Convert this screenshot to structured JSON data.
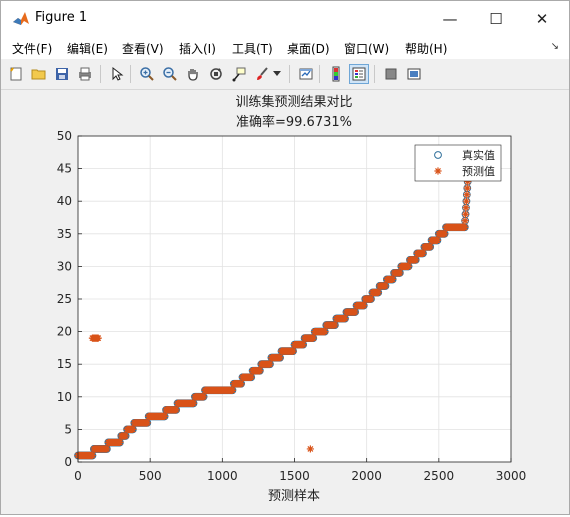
{
  "window": {
    "title": "Figure 1",
    "minimize_symbol": "—",
    "maximize_symbol": "☐",
    "close_symbol": "✕"
  },
  "menu": {
    "items": [
      "文件(F)",
      "编辑(E)",
      "查看(V)",
      "插入(I)",
      "工具(T)",
      "桌面(D)",
      "窗口(W)",
      "帮助(H)"
    ],
    "overflow_symbol": "↘"
  },
  "toolbar": {
    "icons": [
      "new-figure-icon",
      "open-folder-icon",
      "save-icon",
      "print-icon",
      "pointer-icon",
      "zoom-in-icon",
      "zoom-out-icon",
      "pan-hand-icon",
      "rotate-3d-icon",
      "data-cursor-icon",
      "brush-icon",
      "brush-dropdown-icon",
      "link-plot-icon",
      "colorbar-icon",
      "legend-icon",
      "hide-plot-tools-icon",
      "show-plot-tools-icon"
    ]
  },
  "chart_data": {
    "type": "scatter",
    "title": "训练集预测结果对比",
    "subtitle": "准确率=99.6731%",
    "xlabel": "预测样本",
    "ylabel": "",
    "xlim": [
      0,
      3000
    ],
    "ylim": [
      0,
      50
    ],
    "xticks": [
      "0",
      "500",
      "1000",
      "1500",
      "2000",
      "2500",
      "3000"
    ],
    "yticks": [
      "0",
      "5",
      "10",
      "15",
      "20",
      "25",
      "30",
      "35",
      "40",
      "45",
      "50"
    ],
    "grid": true,
    "legend_position": "top-right",
    "colors": {
      "true": "#2f6f9a",
      "pred": "#d95319"
    },
    "series": [
      {
        "name": "真实值",
        "marker": "circle",
        "points": [
          [
            0,
            1
          ],
          [
            100,
            1
          ],
          [
            110,
            2
          ],
          [
            200,
            2
          ],
          [
            210,
            3
          ],
          [
            290,
            3
          ],
          [
            300,
            4
          ],
          [
            330,
            4
          ],
          [
            340,
            5
          ],
          [
            380,
            5
          ],
          [
            390,
            6
          ],
          [
            480,
            6
          ],
          [
            490,
            7
          ],
          [
            600,
            7
          ],
          [
            610,
            8
          ],
          [
            680,
            8
          ],
          [
            690,
            9
          ],
          [
            800,
            9
          ],
          [
            810,
            10
          ],
          [
            870,
            10
          ],
          [
            880,
            11
          ],
          [
            1070,
            11
          ],
          [
            1080,
            12
          ],
          [
            1130,
            12
          ],
          [
            1140,
            13
          ],
          [
            1200,
            13
          ],
          [
            1210,
            14
          ],
          [
            1260,
            14
          ],
          [
            1270,
            15
          ],
          [
            1330,
            15
          ],
          [
            1340,
            16
          ],
          [
            1400,
            16
          ],
          [
            1410,
            17
          ],
          [
            1490,
            17
          ],
          [
            1500,
            18
          ],
          [
            1560,
            18
          ],
          [
            1570,
            19
          ],
          [
            1630,
            19
          ],
          [
            1640,
            20
          ],
          [
            1710,
            20
          ],
          [
            1720,
            21
          ],
          [
            1780,
            21
          ],
          [
            1790,
            22
          ],
          [
            1850,
            22
          ],
          [
            1860,
            23
          ],
          [
            1920,
            23
          ],
          [
            1930,
            24
          ],
          [
            1980,
            24
          ],
          [
            1990,
            25
          ],
          [
            2030,
            25
          ],
          [
            2040,
            26
          ],
          [
            2080,
            26
          ],
          [
            2090,
            27
          ],
          [
            2130,
            27
          ],
          [
            2140,
            28
          ],
          [
            2180,
            28
          ],
          [
            2190,
            29
          ],
          [
            2230,
            29
          ],
          [
            2240,
            30
          ],
          [
            2290,
            30
          ],
          [
            2300,
            31
          ],
          [
            2340,
            31
          ],
          [
            2350,
            32
          ],
          [
            2390,
            32
          ],
          [
            2400,
            33
          ],
          [
            2440,
            33
          ],
          [
            2450,
            34
          ],
          [
            2490,
            34
          ],
          [
            2500,
            35
          ],
          [
            2540,
            35
          ],
          [
            2550,
            36
          ],
          [
            2680,
            36
          ],
          [
            2682,
            37
          ],
          [
            2685,
            38
          ],
          [
            2688,
            39
          ],
          [
            2691,
            40
          ],
          [
            2694,
            41
          ],
          [
            2697,
            42
          ],
          [
            2700,
            43
          ],
          [
            2705,
            44
          ],
          [
            2710,
            45
          ],
          [
            2715,
            46
          ],
          [
            2725,
            47
          ],
          [
            2750,
            48
          ]
        ]
      },
      {
        "name": "预测值",
        "marker": "star",
        "points": [
          [
            0,
            1
          ],
          [
            100,
            1
          ],
          [
            110,
            2
          ],
          [
            200,
            2
          ],
          [
            210,
            3
          ],
          [
            290,
            3
          ],
          [
            300,
            4
          ],
          [
            330,
            4
          ],
          [
            340,
            5
          ],
          [
            380,
            5
          ],
          [
            390,
            6
          ],
          [
            480,
            6
          ],
          [
            490,
            7
          ],
          [
            600,
            7
          ],
          [
            610,
            8
          ],
          [
            680,
            8
          ],
          [
            690,
            9
          ],
          [
            800,
            9
          ],
          [
            810,
            10
          ],
          [
            870,
            10
          ],
          [
            880,
            11
          ],
          [
            1070,
            11
          ],
          [
            1080,
            12
          ],
          [
            1130,
            12
          ],
          [
            1140,
            13
          ],
          [
            1200,
            13
          ],
          [
            1210,
            14
          ],
          [
            1260,
            14
          ],
          [
            1270,
            15
          ],
          [
            1330,
            15
          ],
          [
            1340,
            16
          ],
          [
            1400,
            16
          ],
          [
            1410,
            17
          ],
          [
            1490,
            17
          ],
          [
            1500,
            18
          ],
          [
            1560,
            18
          ],
          [
            1570,
            19
          ],
          [
            1630,
            19
          ],
          [
            1640,
            20
          ],
          [
            1710,
            20
          ],
          [
            1720,
            21
          ],
          [
            1780,
            21
          ],
          [
            1790,
            22
          ],
          [
            1850,
            22
          ],
          [
            1860,
            23
          ],
          [
            1920,
            23
          ],
          [
            1930,
            24
          ],
          [
            1980,
            24
          ],
          [
            1990,
            25
          ],
          [
            2030,
            25
          ],
          [
            2040,
            26
          ],
          [
            2080,
            26
          ],
          [
            2090,
            27
          ],
          [
            2130,
            27
          ],
          [
            2140,
            28
          ],
          [
            2180,
            28
          ],
          [
            2190,
            29
          ],
          [
            2230,
            29
          ],
          [
            2240,
            30
          ],
          [
            2290,
            30
          ],
          [
            2300,
            31
          ],
          [
            2340,
            31
          ],
          [
            2350,
            32
          ],
          [
            2390,
            32
          ],
          [
            2400,
            33
          ],
          [
            2440,
            33
          ],
          [
            2450,
            34
          ],
          [
            2490,
            34
          ],
          [
            2500,
            35
          ],
          [
            2540,
            35
          ],
          [
            2550,
            36
          ],
          [
            2680,
            36
          ],
          [
            2682,
            37
          ],
          [
            2685,
            38
          ],
          [
            2688,
            39
          ],
          [
            2691,
            40
          ],
          [
            2694,
            41
          ],
          [
            2697,
            42
          ],
          [
            2700,
            43
          ],
          [
            2705,
            44
          ],
          [
            2710,
            45
          ],
          [
            2715,
            46
          ],
          [
            2725,
            47
          ],
          [
            100,
            19
          ],
          [
            140,
            19
          ],
          [
            1610,
            2
          ]
        ]
      }
    ]
  }
}
